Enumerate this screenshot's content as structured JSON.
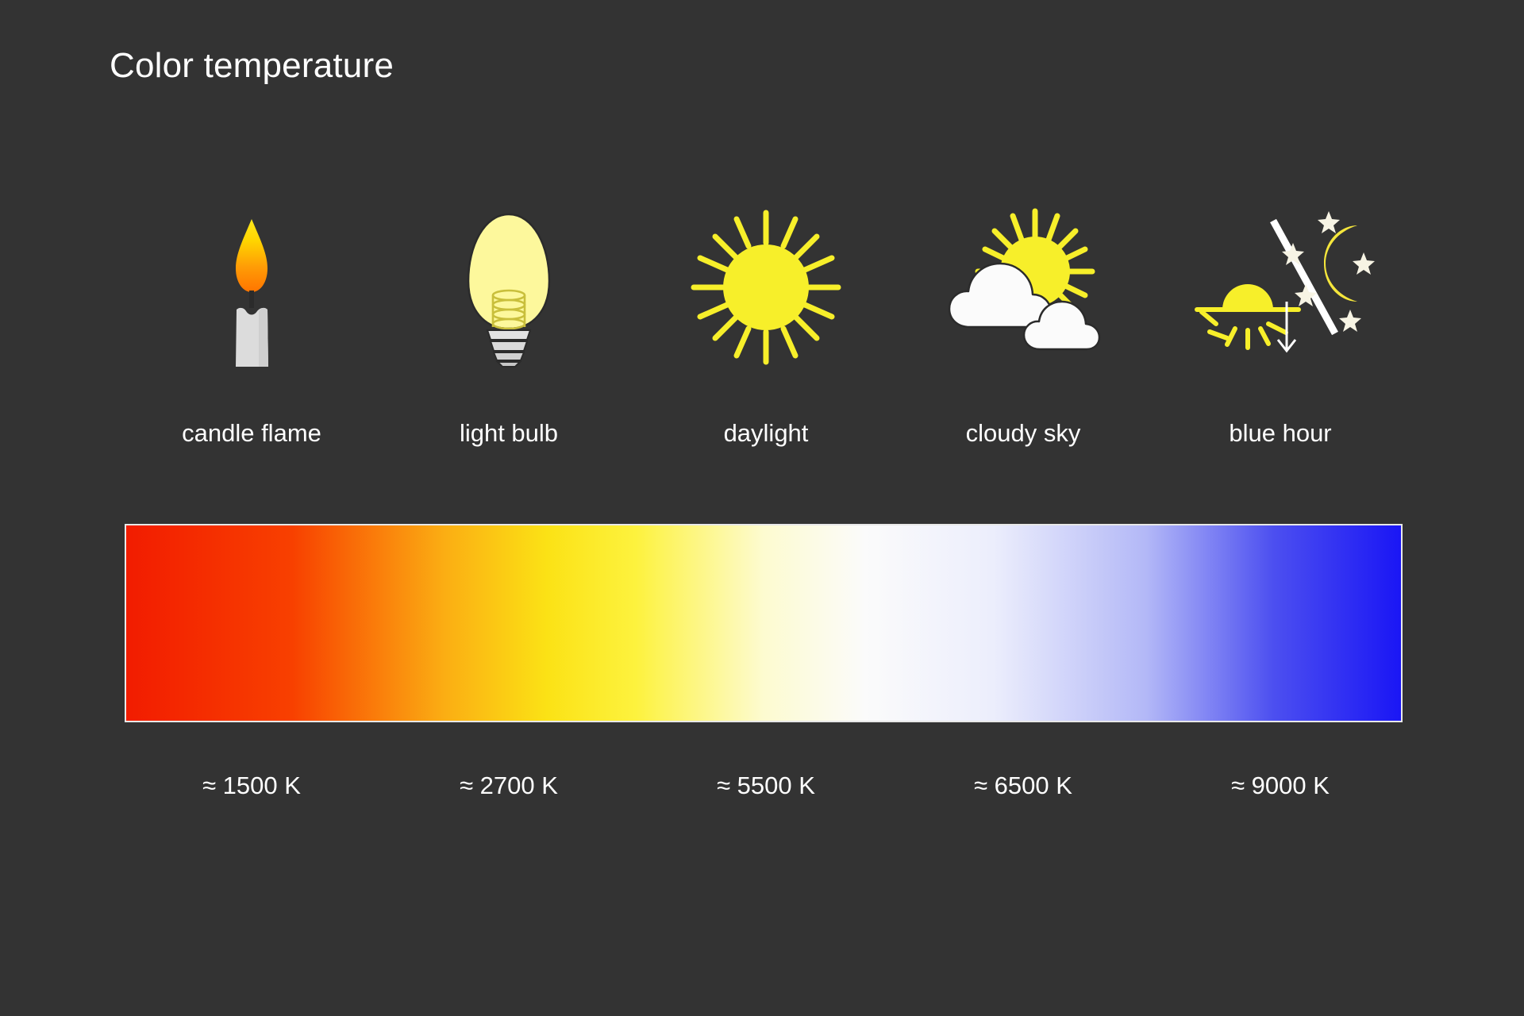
{
  "title": "Color temperature",
  "background_color": "#333333",
  "text_color": "#ffffff",
  "bar": {
    "border_color": "#e8e8e8",
    "stops": [
      {
        "pos": 0,
        "color": "#f21c00"
      },
      {
        "pos": 13,
        "color": "#f84000"
      },
      {
        "pos": 25,
        "color": "#fbae13"
      },
      {
        "pos": 33,
        "color": "#fbe215"
      },
      {
        "pos": 40,
        "color": "#fdf23e"
      },
      {
        "pos": 50,
        "color": "#fdfbd0"
      },
      {
        "pos": 58,
        "color": "#fbfbfb"
      },
      {
        "pos": 68,
        "color": "#eceefc"
      },
      {
        "pos": 80,
        "color": "#b3b8f7"
      },
      {
        "pos": 90,
        "color": "#4c4ff0"
      },
      {
        "pos": 100,
        "color": "#1a16f5"
      }
    ]
  },
  "sources": [
    {
      "icon": "candle-flame-icon",
      "label": "candle flame",
      "kelvin": "≈ 1500 K",
      "colors": {
        "flame_top": "#ffe81a",
        "flame_bottom": "#ff7800",
        "wick": "#2b2b2b",
        "wax": "#dcdcdc",
        "wax_shade": "#c6c6c6"
      }
    },
    {
      "icon": "light-bulb-icon",
      "label": "light bulb",
      "kelvin": "≈ 2700 K",
      "colors": {
        "glass": "#fdf89c",
        "base": "#d8d8d8",
        "outline": "#2b2b2b"
      }
    },
    {
      "icon": "daylight-sun-icon",
      "label": "daylight",
      "kelvin": "≈ 5500 K",
      "colors": {
        "sun": "#f7ef2a"
      }
    },
    {
      "icon": "cloudy-sky-icon",
      "label": "cloudy sky",
      "kelvin": "≈ 6500 K",
      "colors": {
        "sun": "#f7ef2a",
        "cloud": "#fbfbfb",
        "outline": "#2b2b2b"
      }
    },
    {
      "icon": "blue-hour-icon",
      "label": "blue hour",
      "kelvin": "≈ 9000 K",
      "colors": {
        "sun": "#f7ef2a",
        "moon": "#f5e63c",
        "star": "#f7f4e4",
        "divider": "#ffffff",
        "arrow": "#ffffff"
      }
    }
  ]
}
